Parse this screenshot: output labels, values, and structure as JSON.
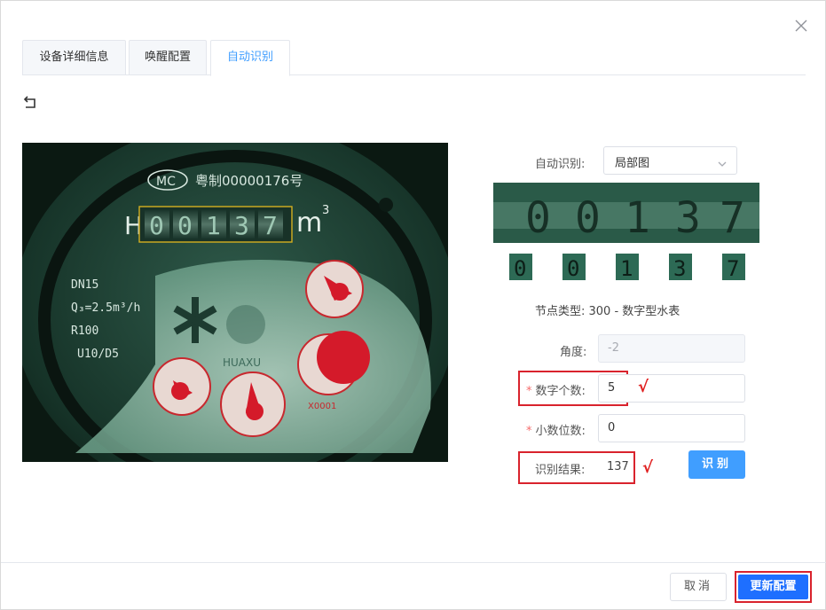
{
  "tabs": [
    {
      "label": "设备详细信息",
      "active": false
    },
    {
      "label": "唤醒配置",
      "active": false
    },
    {
      "label": "自动识别",
      "active": true
    }
  ],
  "meter": {
    "brand_text": "MC",
    "cert_text": "粤制00000176号",
    "reading": [
      "0",
      "0",
      "1",
      "3",
      "7"
    ],
    "unit": "m",
    "unit_sup": "3",
    "spec_lines": [
      "DN15",
      "Q₃=2.5m³/h",
      "R100",
      "U10/D5"
    ],
    "maker": "HUAXU",
    "dial_label": "X0001"
  },
  "form": {
    "auto_label": "自动识别:",
    "auto_value": "局部图",
    "crop_digits": [
      "0",
      "0",
      "1",
      "3",
      "7"
    ],
    "node_type": "节点类型:  300 - 数字型水表",
    "angle_label": "角度:",
    "angle_value": "-2",
    "digit_count_label": "数字个数:",
    "digit_count_value": "5",
    "decimal_label": "小数位数:",
    "decimal_value": "0",
    "result_label": "识别结果:",
    "result_value": "137",
    "check_mark": "√",
    "recognize_button": "识别"
  },
  "footer": {
    "cancel_label": "取消",
    "update_label": "更新配置"
  },
  "colors": {
    "accent": "#409eff",
    "primary_btn": "#1e6fff",
    "highlight": "#d9232d",
    "required": "#f56c6c"
  }
}
